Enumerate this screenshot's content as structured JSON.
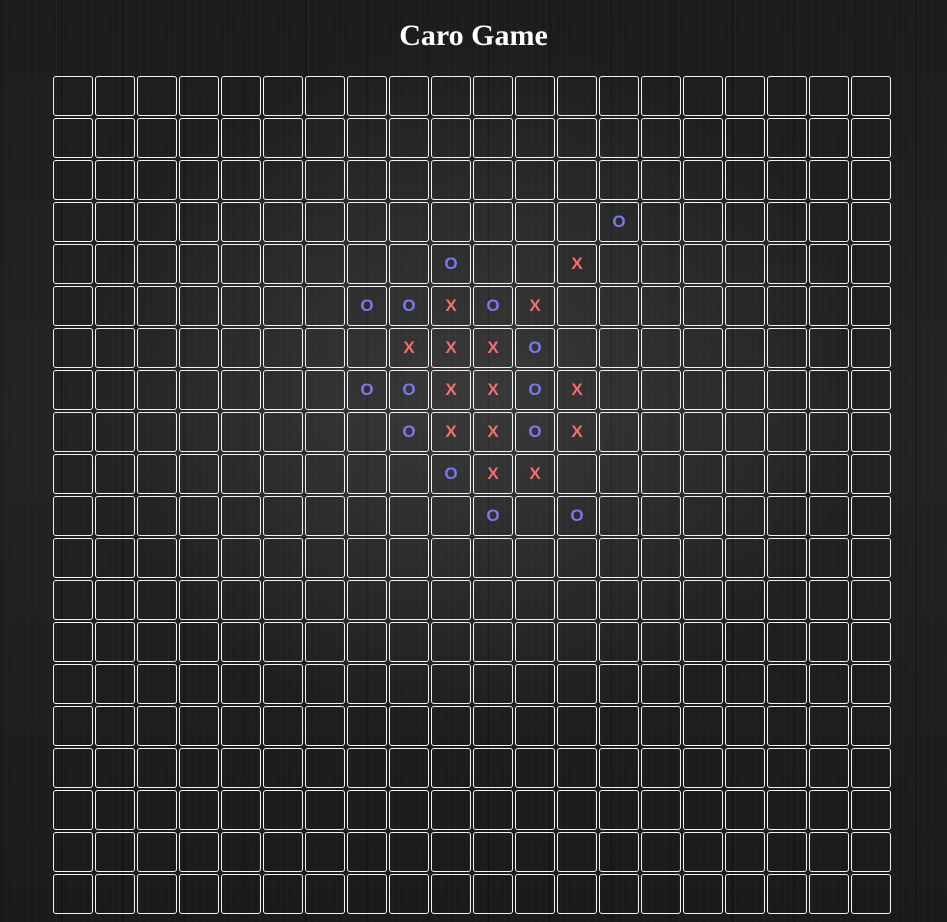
{
  "title": "Caro Game",
  "board": {
    "rows": 20,
    "cols": 20,
    "marks": [
      {
        "row": 3,
        "col": 13,
        "symbol": "O"
      },
      {
        "row": 4,
        "col": 9,
        "symbol": "O"
      },
      {
        "row": 4,
        "col": 12,
        "symbol": "X"
      },
      {
        "row": 5,
        "col": 7,
        "symbol": "O"
      },
      {
        "row": 5,
        "col": 8,
        "symbol": "O"
      },
      {
        "row": 5,
        "col": 9,
        "symbol": "X"
      },
      {
        "row": 5,
        "col": 10,
        "symbol": "O"
      },
      {
        "row": 5,
        "col": 11,
        "symbol": "X"
      },
      {
        "row": 6,
        "col": 8,
        "symbol": "X"
      },
      {
        "row": 6,
        "col": 9,
        "symbol": "X"
      },
      {
        "row": 6,
        "col": 10,
        "symbol": "X"
      },
      {
        "row": 6,
        "col": 11,
        "symbol": "O"
      },
      {
        "row": 7,
        "col": 7,
        "symbol": "O"
      },
      {
        "row": 7,
        "col": 8,
        "symbol": "O"
      },
      {
        "row": 7,
        "col": 9,
        "symbol": "X"
      },
      {
        "row": 7,
        "col": 10,
        "symbol": "X"
      },
      {
        "row": 7,
        "col": 11,
        "symbol": "O"
      },
      {
        "row": 7,
        "col": 12,
        "symbol": "X"
      },
      {
        "row": 8,
        "col": 8,
        "symbol": "O"
      },
      {
        "row": 8,
        "col": 9,
        "symbol": "X"
      },
      {
        "row": 8,
        "col": 10,
        "symbol": "X"
      },
      {
        "row": 8,
        "col": 11,
        "symbol": "O"
      },
      {
        "row": 8,
        "col": 12,
        "symbol": "X"
      },
      {
        "row": 9,
        "col": 9,
        "symbol": "O"
      },
      {
        "row": 9,
        "col": 10,
        "symbol": "X"
      },
      {
        "row": 9,
        "col": 11,
        "symbol": "X"
      },
      {
        "row": 10,
        "col": 10,
        "symbol": "O"
      },
      {
        "row": 10,
        "col": 12,
        "symbol": "O"
      }
    ]
  },
  "colors": {
    "x_color": "#f07070",
    "o_color": "#7a78ee",
    "grid_line": "#f2f2f2",
    "background": "#1f1f1f",
    "title": "#ffffff"
  }
}
